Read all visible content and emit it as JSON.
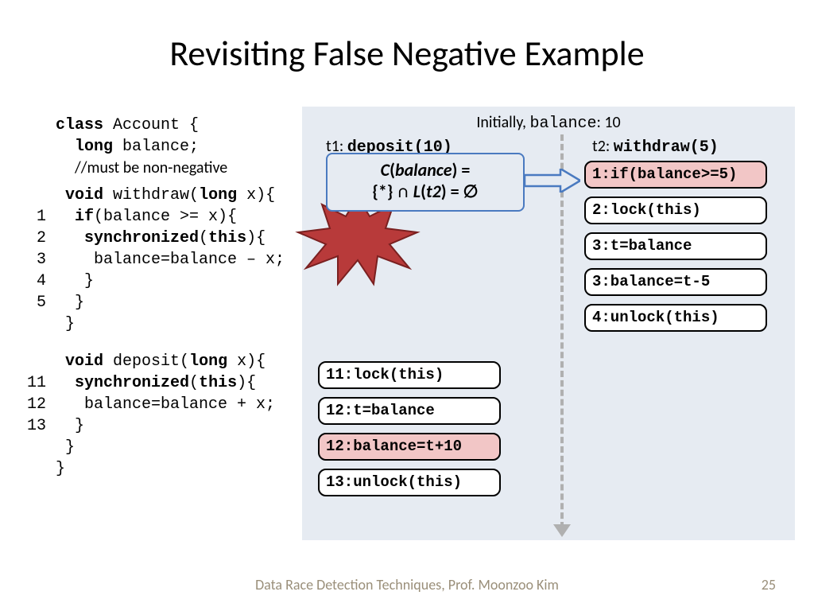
{
  "title": "Revisiting False Negative Example",
  "code": {
    "l0a": "class",
    "l0b": " Account {",
    "l1a": "long",
    "l1b": " balance;",
    "l2": "//must be non-negative",
    "l3a": "void",
    "l3b": " withdraw(",
    "l3c": "long",
    "l3d": " x){",
    "l4a": "if",
    "l4b": "(balance >= x){",
    "l5a": "synchronized",
    "l5b": "(",
    "l5c": "this",
    "l5d": "){",
    "l6": "balance=balance – x;",
    "l7": "}",
    "l8": "}",
    "l9": "}",
    "d1a": "void",
    "d1b": " deposit(",
    "d1c": "long",
    "d1d": " x){",
    "d2a": "synchronized",
    "d2b": "(",
    "d2c": "this",
    "d2d": "){",
    "d3": "balance=balance + x;",
    "d4": "}",
    "d5": "}",
    "d6": "}",
    "ln1": "1",
    "ln2": "2",
    "ln3": "3",
    "ln4": "4",
    "ln5": "5",
    "ln11": "11",
    "ln12": "12",
    "ln13": "13"
  },
  "diagram": {
    "initially_prefix": "Initially, ",
    "initially_mono": "balance",
    "initially_suffix": ": 10",
    "t1_prefix": "t1: ",
    "t1_mono": "deposit(10)",
    "t2_prefix": "t2: ",
    "t2_mono": "withdraw(5)",
    "t2_steps": {
      "s1": "1:if(balance>=5)",
      "s2": "2:lock(this)",
      "s3": "3:t=balance",
      "s4": "3:balance=t-5",
      "s5": "4:unlock(this)"
    },
    "t1_steps": {
      "s1": "11:lock(this)",
      "s2": "12:t=balance",
      "s3": "12:balance=t+10",
      "s4": "13:unlock(this)"
    }
  },
  "callout": {
    "line1_a": "C",
    "line1_b": "(",
    "line1_c": "balance",
    "line1_d": ") =",
    "line2_a": "{*} ∩ ",
    "line2_b": "L",
    "line2_c": "(",
    "line2_d": "t2",
    "line2_e": ") = ∅"
  },
  "footer": "Data Race Detection Techniques, Prof. Moonzoo Kim",
  "page": "25"
}
